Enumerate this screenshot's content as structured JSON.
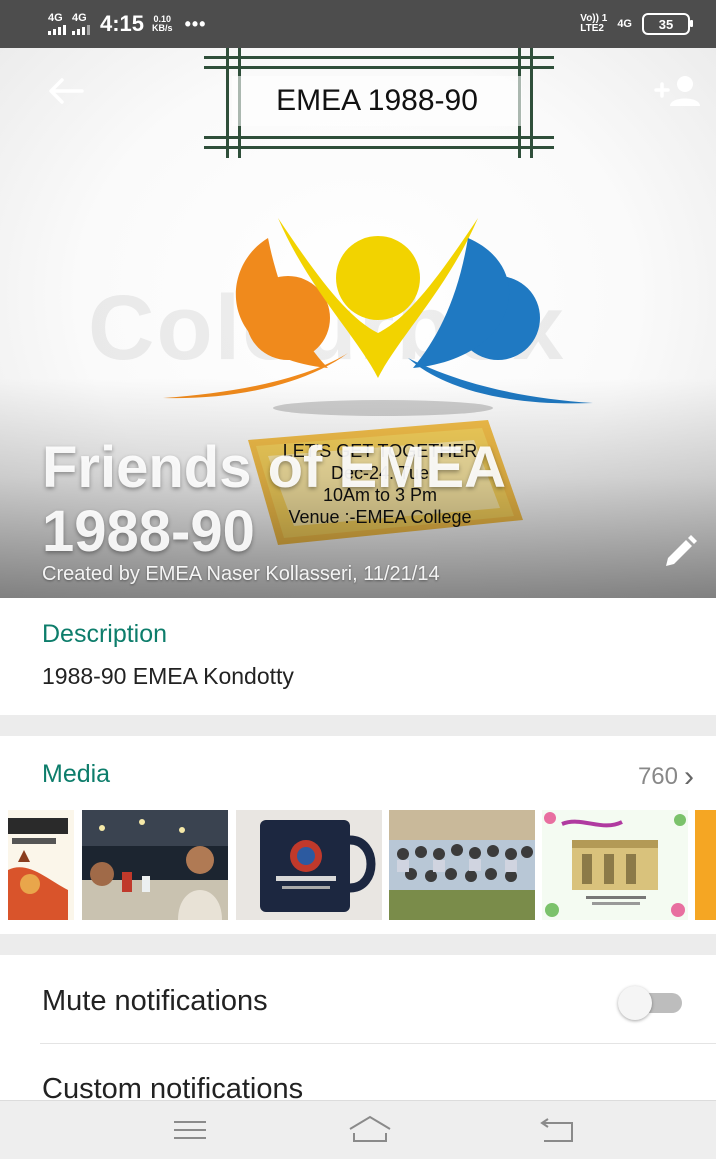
{
  "status_bar": {
    "signal_1": "4G",
    "signal_2": "4G",
    "time": "4:15",
    "speed_value": "0.10",
    "speed_unit": "KB/s",
    "more": "•••",
    "volte_top": "Vo)) 1",
    "volte_bottom": "LTE2",
    "network": "4G",
    "battery": "35"
  },
  "header": {
    "frame_title": "EMEA 1988-90",
    "watermark": "Colourbox",
    "invite_lines": [
      "LET'S GET TOGETHER",
      "Dec-24. Tue",
      "10Am to 3 Pm",
      "Venue :-EMEA College"
    ],
    "group_name_line1": "Friends of EMEA",
    "group_name_line2": "1988-90",
    "created_by": "Created by EMEA Naser Kollasseri, 11/21/14",
    "icons": {
      "back": "back-arrow-icon",
      "add": "add-participant-icon",
      "edit": "edit-pencil-icon"
    }
  },
  "description": {
    "heading": "Description",
    "text": "1988-90 EMEA Kondotty"
  },
  "media": {
    "heading": "Media",
    "count": "760",
    "chevron": "›",
    "thumbnails": [
      "poster-thumbnail",
      "restaurant-photo",
      "mug-photo",
      "group-photo",
      "greeting-card",
      "partial-thumbnail"
    ]
  },
  "settings": {
    "mute_label": "Mute notifications",
    "mute_enabled": false,
    "custom_label": "Custom notifications"
  },
  "colors": {
    "accent": "#0d7d6b",
    "status_bar": "#4d4d4d",
    "logo_orange": "#f08a1c",
    "logo_yellow": "#f2d300",
    "logo_blue": "#1f79c2"
  },
  "nav_bar": {
    "menu": "menu-icon",
    "home": "home-icon",
    "back": "back-icon"
  }
}
